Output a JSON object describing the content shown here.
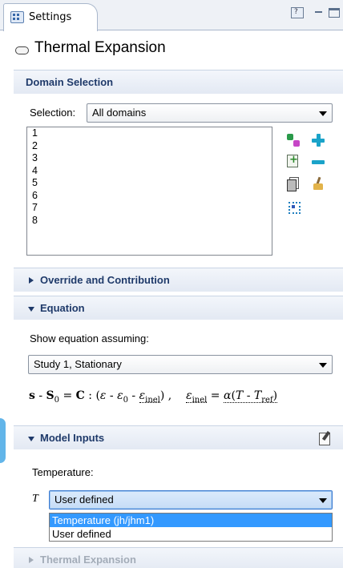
{
  "window": {
    "tab_label": "Settings",
    "tab_icon": "settings-grid-icon",
    "controls": [
      "help-icon",
      "minimize-icon",
      "maximize-icon"
    ]
  },
  "node": {
    "icon": "thermal-expansion-node-icon",
    "title": "Thermal Expansion"
  },
  "domain_selection": {
    "header": "Domain Selection",
    "selection_label": "Selection:",
    "selection_value": "All domains",
    "domains": [
      "1",
      "2",
      "3",
      "4",
      "5",
      "6",
      "7",
      "8"
    ],
    "side_icons": [
      "paste-selection-icon",
      "plus-icon",
      "add-to-selection-icon",
      "minus-icon",
      "copy-selection-icon",
      "clear-selection-icon",
      "zoom-to-selection-icon"
    ]
  },
  "override": {
    "header": "Override and Contribution"
  },
  "equation": {
    "header": "Equation",
    "show_label": "Show equation assuming:",
    "study_value": "Study 1, Stationary"
  },
  "model_inputs": {
    "header": "Model Inputs",
    "temperature_label": "Temperature:",
    "symbol": "T",
    "temperature_value": "User defined",
    "options": [
      "Temperature (jh/jhm1)",
      "User defined"
    ],
    "highlighted_option": "Temperature (jh/jhm1)"
  },
  "thermal_expansion": {
    "header": "Thermal Expansion"
  }
}
